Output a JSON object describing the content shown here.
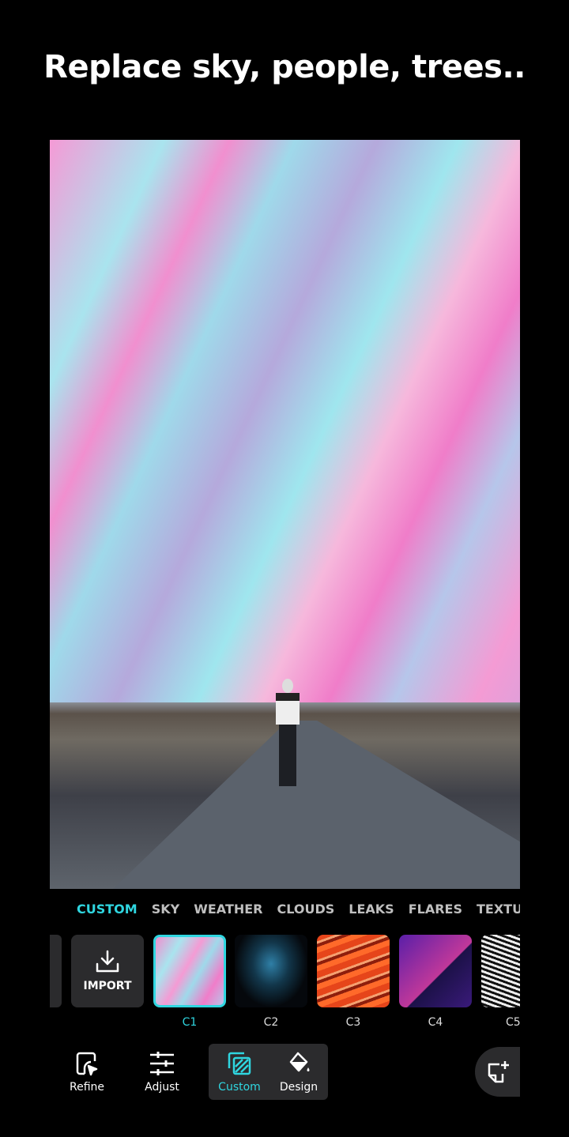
{
  "headline": "Replace sky, people, trees..",
  "categories": [
    "CUSTOM",
    "SKY",
    "WEATHER",
    "CLOUDS",
    "LEAKS",
    "FLARES",
    "TEXTURES"
  ],
  "active_category": "CUSTOM",
  "import_label": "IMPORT",
  "thumbnails": [
    "C1",
    "C2",
    "C3",
    "C4",
    "C5"
  ],
  "selected_thumbnail": "C1",
  "toolbar": {
    "refine": "Refine",
    "adjust": "Adjust",
    "custom": "Custom",
    "design": "Design"
  },
  "colors": {
    "accent": "#2fd6e0",
    "panel": "#2b2b2d"
  }
}
